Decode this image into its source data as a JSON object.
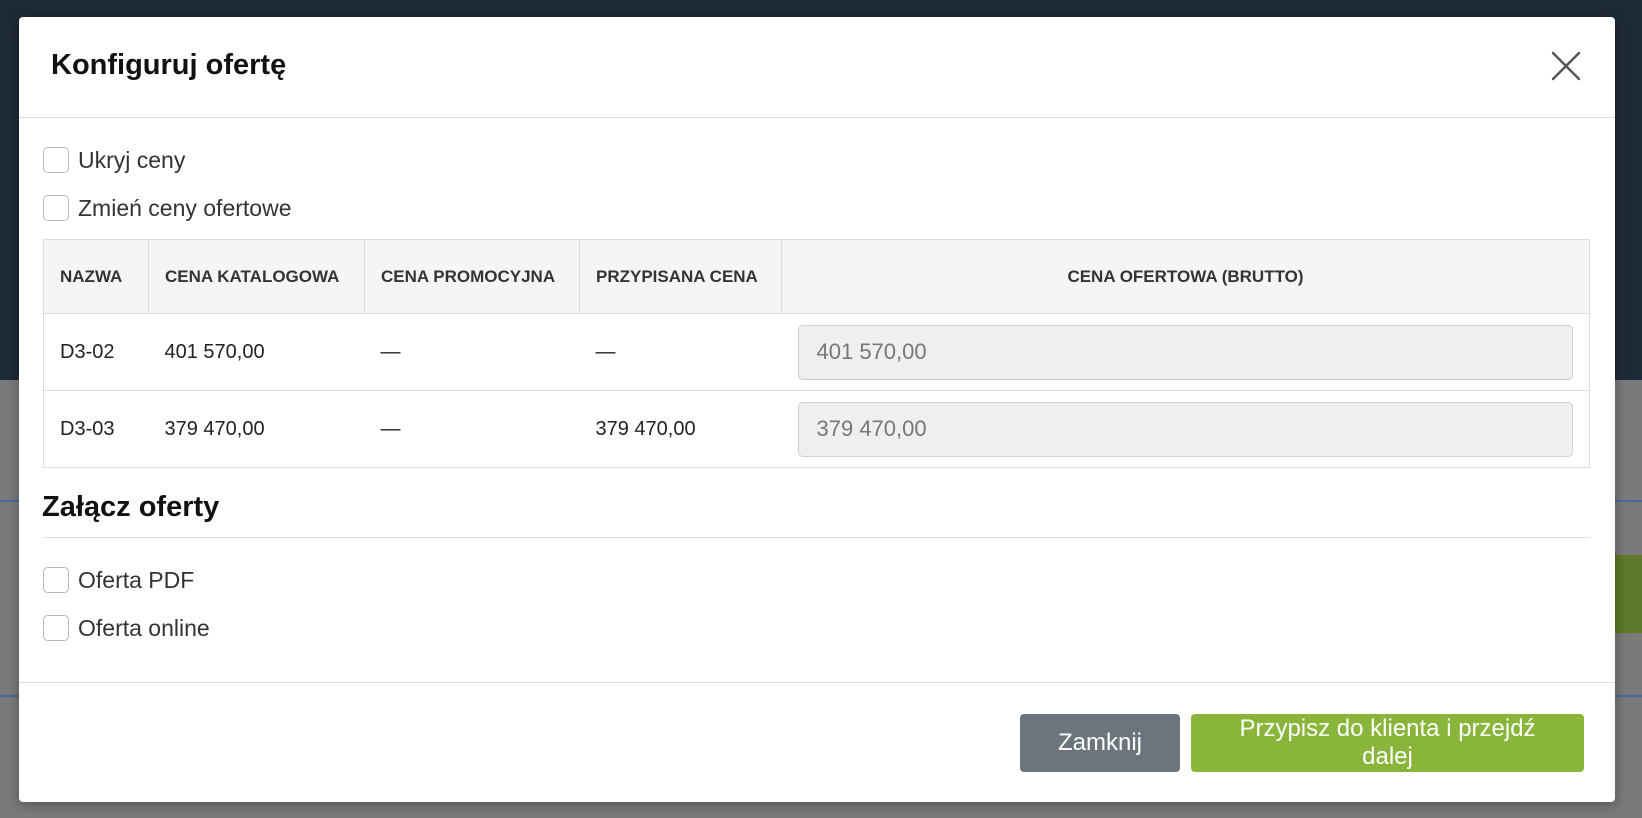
{
  "modal": {
    "title": "Konfiguruj ofertę",
    "close_icon": "close-icon"
  },
  "options": {
    "hide_prices": "Ukryj ceny",
    "change_prices": "Zmień ceny ofertowe"
  },
  "table": {
    "headers": [
      "NAZWA",
      "CENA KATALOGOWA",
      "CENA PROMOCYJNA",
      "PRZYPISANA CENA",
      "CENA OFERTOWA (BRUTTO)"
    ],
    "rows": [
      {
        "name": "D3-02",
        "catalog": "401 570,00",
        "promo": "—",
        "assigned": "—",
        "offer": "401 570,00"
      },
      {
        "name": "D3-03",
        "catalog": "379 470,00",
        "promo": "—",
        "assigned": "379 470,00",
        "offer": "379 470,00"
      }
    ]
  },
  "attach": {
    "title": "Załącz oferty",
    "pdf": "Oferta PDF",
    "online": "Oferta online"
  },
  "footer": {
    "close_label": "Zamknij",
    "primary_label": "Przypisz do klienta i przejdź dalej"
  },
  "colors": {
    "primary": "#8ab53b",
    "secondary": "#6c757d"
  }
}
